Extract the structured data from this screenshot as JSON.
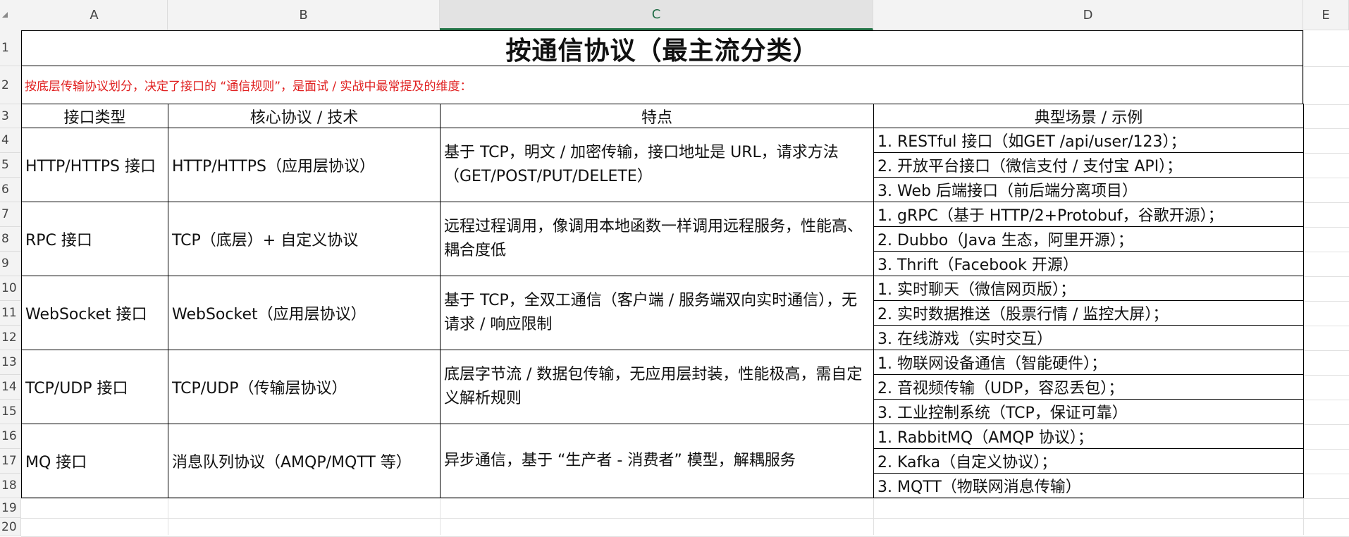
{
  "columns": [
    "A",
    "B",
    "C",
    "D",
    "E"
  ],
  "rows": [
    "1",
    "2",
    "3",
    "4",
    "5",
    "6",
    "7",
    "8",
    "9",
    "10",
    "11",
    "12",
    "13",
    "14",
    "15",
    "16",
    "17",
    "18",
    "19",
    "20"
  ],
  "title": "按通信协议（最主流分类）",
  "subtitle": "按底层传输协议划分，决定了接口的 “通信规则”，是面试 / 实战中最常提及的维度：",
  "headers": [
    "接口类型",
    "核心协议 / 技术",
    "特点",
    "典型场景 / 示例"
  ],
  "groups": [
    {
      "type": "HTTP/HTTPS 接口",
      "protocol": "HTTP/HTTPS（应用层协议）",
      "feature": "基于 TCP，明文 / 加密传输，接口地址是 URL，请求方法（GET/POST/PUT/DELETE）",
      "examples": [
        "1. RESTful 接口（如GET /api/user/123）；",
        "2. 开放平台接口（微信支付 / 支付宝 API）；",
        "3. Web 后端接口（前后端分离项目）"
      ]
    },
    {
      "type": "RPC 接口",
      "protocol": "TCP（底层）+ 自定义协议",
      "feature": "远程过程调用，像调用本地函数一样调用远程服务，性能高、耦合度低",
      "examples": [
        "1. gRPC（基于 HTTP/2+Protobuf，谷歌开源）；",
        "2. Dubbo（Java 生态，阿里开源）；",
        "3. Thrift（Facebook 开源）"
      ]
    },
    {
      "type": "WebSocket 接口",
      "protocol": "WebSocket（应用层协议）",
      "feature": "基于 TCP，全双工通信（客户端 / 服务端双向实时通信），无请求 / 响应限制",
      "examples": [
        "1. 实时聊天（微信网页版）；",
        "2. 实时数据推送（股票行情 / 监控大屏）；",
        "3. 在线游戏（实时交互）"
      ]
    },
    {
      "type": "TCP/UDP 接口",
      "protocol": "TCP/UDP（传输层协议）",
      "feature": "底层字节流 / 数据包传输，无应用层封装，性能极高，需自定义解析规则",
      "examples": [
        "1. 物联网设备通信（智能硬件）；",
        "2. 音视频传输（UDP，容忍丢包）；",
        "3. 工业控制系统（TCP，保证可靠）"
      ]
    },
    {
      "type": "MQ 接口",
      "protocol": "消息队列协议（AMQP/MQTT 等）",
      "feature": "异步通信，基于 “生产者 - 消费者” 模型，解耦服务",
      "examples": [
        "1. RabbitMQ（AMQP 协议）；",
        "2. Kafka（自定义协议）；",
        "3. MQTT（物联网消息传输）"
      ]
    }
  ],
  "selected_column": "C",
  "colors": {
    "subtitle": "#e02020",
    "selected_header_line": "#217346"
  }
}
